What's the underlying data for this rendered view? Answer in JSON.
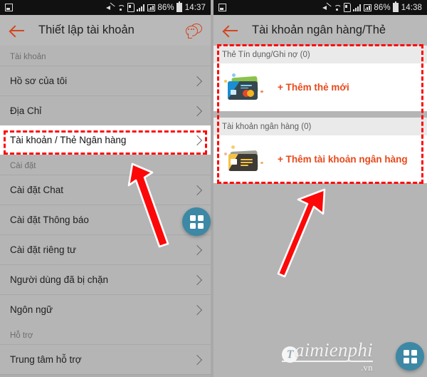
{
  "left_phone": {
    "status_bar": {
      "battery": "86%",
      "time": "14:37",
      "icons": [
        "notification-icon",
        "mute-icon",
        "wifi-icon",
        "sdcard-icon",
        "signal-icon",
        "signal-box-icon",
        "battery-icon"
      ]
    },
    "app_bar": {
      "back": "back-arrow-icon",
      "title": "Thiết lập tài khoản",
      "action": "chat-bubble-icon"
    },
    "groups": [
      {
        "header": "Tài khoản",
        "items": [
          {
            "label": "Hồ sơ của tôi",
            "highlighted": false
          },
          {
            "label": "Địa Chỉ",
            "highlighted": false
          },
          {
            "label": "Tài khoản / Thẻ Ngân hàng",
            "highlighted": true
          }
        ]
      },
      {
        "header": "Cài đặt",
        "items": [
          {
            "label": "Cài đặt Chat",
            "highlighted": false
          },
          {
            "label": "Cài đặt Thông báo",
            "highlighted": false
          },
          {
            "label": "Cài đặt riêng tư",
            "highlighted": false
          },
          {
            "label": "Người dùng đã bị chặn",
            "highlighted": false
          },
          {
            "label": "Ngôn ngữ",
            "highlighted": false
          }
        ]
      },
      {
        "header": "Hỗ trợ",
        "items": [
          {
            "label": "Trung tâm hỗ trợ",
            "highlighted": false
          }
        ]
      }
    ]
  },
  "right_phone": {
    "status_bar": {
      "battery": "86%",
      "time": "14:38"
    },
    "app_bar": {
      "back": "back-arrow-icon",
      "title": "Tài khoản ngân hàng/Thẻ"
    },
    "sections": [
      {
        "title": "Thẻ Tín dụng/Ghi nợ (0)",
        "icon": "credit-card-icon",
        "action_label": "+ Thêm thẻ mới"
      },
      {
        "title": "Tài khoản ngân hàng (0)",
        "icon": "wallet-icon",
        "action_label": "+ Thêm tài khoản ngân hàng"
      }
    ]
  },
  "annotations": {
    "highlight_color": "#fd0808",
    "arrow_color": "#fd0808",
    "arrow_outline": "#ffffff"
  },
  "fab": {
    "icon": "grid-apps-icon",
    "color": "#3d88a4"
  },
  "watermark": {
    "badge": "T",
    "brand": "aimienphi",
    "tld": ".vn"
  }
}
